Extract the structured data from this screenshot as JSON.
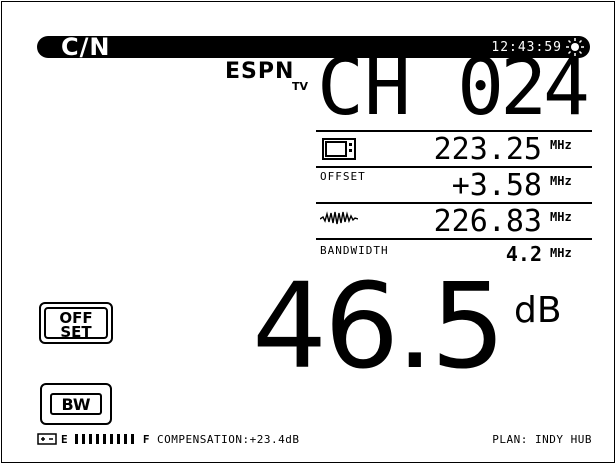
{
  "header": {
    "mode": "C/N",
    "time": "12:43:59",
    "brightness_icon": "sun-icon"
  },
  "channel": {
    "name": "ESPN",
    "sub": "TV",
    "label": "CH",
    "number": "024"
  },
  "rows": {
    "tv_freq": {
      "icon": "tv-icon",
      "value": "223.25",
      "unit": "MHz"
    },
    "offset": {
      "label": "OFFSET",
      "value": "+3.58",
      "unit": "MHz"
    },
    "signal_freq": {
      "icon": "waveform-icon",
      "value": "226.83",
      "unit": "MHz"
    },
    "bandwidth": {
      "label": "BANDWIDTH",
      "value": "4.2",
      "unit": "MHz"
    }
  },
  "buttons": {
    "offset_line1": "OFF",
    "offset_line2": "SET",
    "bw": "BW"
  },
  "measurement": {
    "value": "46.5",
    "unit": "dB"
  },
  "footer": {
    "battery_icon": "battery-icon",
    "gauge_left": "E",
    "gauge_right": "F",
    "gauge_level": 0.9,
    "compensation": "COMPENSATION:+23.4dB",
    "plan": "PLAN: INDY HUB"
  }
}
